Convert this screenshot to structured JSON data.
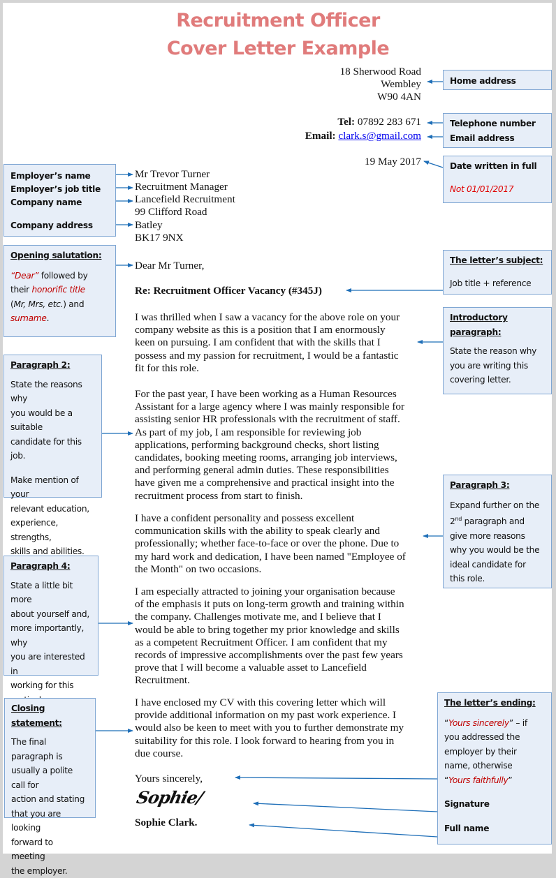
{
  "title": {
    "line1": "Recruitment Officer",
    "line2": "Cover Letter Example"
  },
  "sender": {
    "address": [
      "18 Sherwood Road",
      "Wembley",
      "W90 4AN"
    ],
    "tel_label": "Tel:",
    "tel_value": "07892 283 671",
    "email_label": "Email:",
    "email_value": "clark.s@gmail.com",
    "date": "19 May 2017"
  },
  "recipient": {
    "lines": [
      "Mr Trevor Turner",
      "Recruitment Manager",
      "Lancefield Recruitment",
      "99 Clifford Road",
      "Batley",
      "BK17 9NX"
    ]
  },
  "letter": {
    "salutation": "Dear Mr Turner,",
    "subject": "Re: Recruitment Officer Vacancy (#345J)",
    "paragraphs": [
      [
        "I was thrilled when I saw a vacancy for the above role on your",
        "company website as this is a position that I am enormously",
        "keen on pursuing. I am confident that with the skills that I",
        "possess and my passion for recruitment, I would be a fantastic",
        "fit for this role."
      ],
      [
        "For the past year, I have been working as a Human Resources",
        "Assistant for a large agency where I was mainly responsible for",
        "assisting senior HR professionals with the recruitment of staff.",
        "As part of my job, I am responsible for reviewing job",
        "applications, performing background checks, short listing",
        "candidates, booking meeting rooms, arranging job interviews,",
        "and performing general admin duties. These responsibilities",
        "have given me a comprehensive and practical insight into the",
        "recruitment process from start to finish."
      ],
      [
        "I have a confident personality and possess excellent",
        "communication skills with the ability to speak clearly and",
        "professionally; whether face-to-face or over the phone. Due to",
        "my hard work and dedication, I have been named \"Employee of",
        "the Month\" on two occasions."
      ],
      [
        "I am especially attracted to joining your organisation because",
        "of the emphasis it puts on long-term growth and training within",
        "the company. Challenges motivate me, and I believe that I",
        "would be able to bring together my prior knowledge and skills",
        "as a competent Recruitment Officer. I am confident that my",
        "records of impressive accomplishments over the past few years",
        "prove that I will become a valuable asset to Lancefield",
        "Recruitment."
      ],
      [
        "I have enclosed my CV with this covering letter which will",
        "provide additional information on my past work experience. I",
        "would also be keen to meet with you to further demonstrate my",
        "suitability for this role. I look forward to hearing from you in",
        "due course."
      ]
    ],
    "closing": "Yours sincerely,",
    "signature": "Sophie/",
    "full_name": "Sophie Clark."
  },
  "annotations": {
    "home_address": "Home address",
    "telephone": "Telephone number",
    "email": "Email address",
    "date_heading": "Date written in full",
    "date_note": "Not 01/01/2017",
    "employer": {
      "name": "Employer’s name",
      "job_title": "Employer’s job title",
      "company": "Company name",
      "address": "Company address"
    },
    "salutation": {
      "heading": "Opening salutation:",
      "dear": "“Dear”",
      "followed_by": " followed by",
      "their": "their ",
      "honorific": "honorific title",
      "paren_open": "(",
      "examples": "Mr, Mrs, etc.",
      "paren_close": ") and",
      "surname": "surname",
      "period": "."
    },
    "subject": {
      "heading": "The letter’s subject:",
      "body": "Job title + reference"
    },
    "intro": {
      "heading_1": "Introductory",
      "heading_2": "paragraph:",
      "body": [
        "State the reason why",
        "you are writing this",
        "covering letter."
      ]
    },
    "para2": {
      "heading": "Paragraph 2:",
      "body1": [
        "State the reasons why",
        "you would be a suitable",
        "candidate for this job."
      ],
      "body2": [
        "Make mention of your",
        "relevant education,",
        "experience, strengths,",
        "skills and abilities."
      ]
    },
    "para3": {
      "heading": "Paragraph 3:",
      "line1": "Expand further on the",
      "line2_num": "2",
      "line2_sup": "nd",
      "line2_rest": " paragraph and",
      "body": [
        "give more reasons",
        "why you would be the",
        "ideal candidate for",
        "this role."
      ]
    },
    "para4": {
      "heading": "Paragraph 4:",
      "body": [
        "State a little bit more",
        "about yourself and,",
        "more importantly, why",
        "you are interested in",
        "working for this",
        "particular company."
      ]
    },
    "closing": {
      "heading": "Closing statement:",
      "body": [
        "The final paragraph is",
        "usually a polite call for",
        "action and stating",
        "that you are looking",
        "forward to meeting",
        "the employer."
      ]
    },
    "ending": {
      "heading": "The letter’s ending:",
      "q_open": "“",
      "sincerely": "Yours sincerely",
      "q_close_if": "” – if",
      "body": [
        "you addressed the",
        "employer by their",
        "name, otherwise"
      ],
      "q_open2": "“",
      "faithfully": "Yours faithfully",
      "q_close2": "”",
      "signature": "Signature",
      "full_name": "Full name"
    }
  },
  "colors": {
    "title": "#e07b7b",
    "box_fill": "#e7eef8",
    "box_border": "#7fa6d3",
    "arrow": "#1f6fb8",
    "highlight_red": "#c00000",
    "link": "#0000ee"
  }
}
